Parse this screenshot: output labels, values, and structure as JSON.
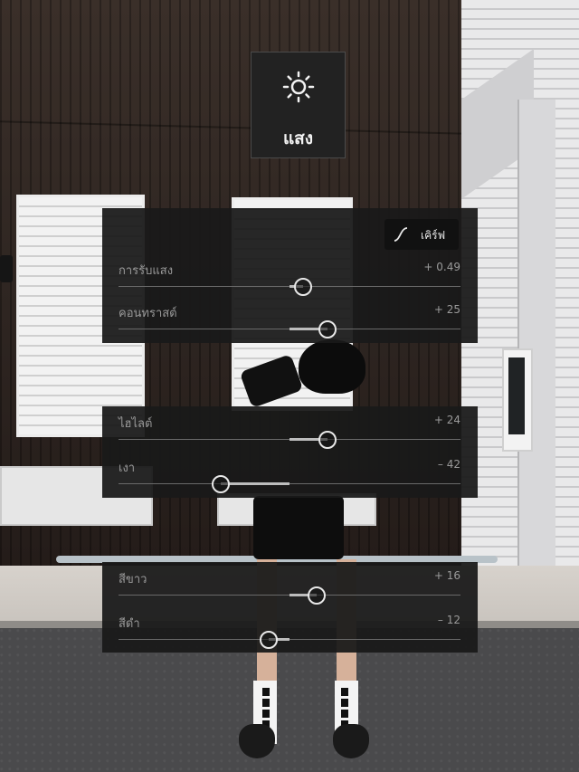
{
  "section": {
    "title": "แสง",
    "icon": "sun-icon"
  },
  "curve_button": {
    "label": "เคิร์ฟ",
    "icon": "curve-icon"
  },
  "sliders": [
    {
      "id": "exposure",
      "label": "การรับแสง",
      "value_text": "+ 0.49",
      "position": 0.54
    },
    {
      "id": "contrast",
      "label": "คอนทราสต์",
      "value_text": "+ 25",
      "position": 0.61
    },
    {
      "id": "highlights",
      "label": "ไฮไลต์",
      "value_text": "+ 24",
      "position": 0.61
    },
    {
      "id": "shadows",
      "label": "เงา",
      "value_text": "– 42",
      "position": 0.3
    },
    {
      "id": "whites",
      "label": "สีขาว",
      "value_text": "+ 16",
      "position": 0.58
    },
    {
      "id": "blacks",
      "label": "สีดำ",
      "value_text": "– 12",
      "position": 0.44
    }
  ],
  "colors": {
    "panel_bg": "#1a1a1a",
    "label": "#9a9a9a",
    "thumb": "#e8e8e8",
    "track": "#6a6a6a"
  }
}
